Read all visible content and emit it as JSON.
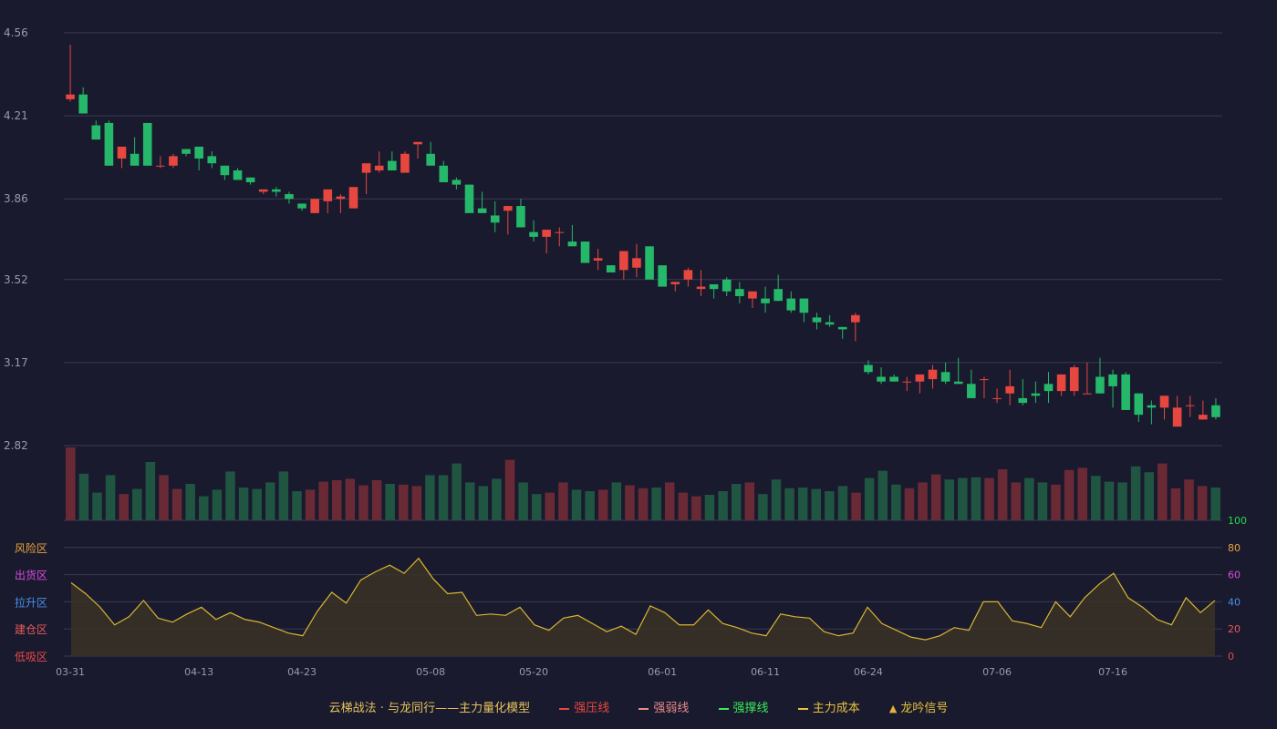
{
  "colors": {
    "background": "#191a2e",
    "up": "#e8473f",
    "down": "#25b86a",
    "up_volume": "#6a2a35",
    "down_volume": "#1f5541",
    "grid": "#3a3b52",
    "axis_text": "#9a9aa8",
    "oscillator_line": "#d9b531",
    "oscillator_fill": "#3a3326"
  },
  "chart_data": [
    {
      "type": "candlestick",
      "x": [
        "03-31",
        "04-01",
        "04-02",
        "04-03",
        "04-04",
        "04-07",
        "04-08",
        "04-09",
        "04-10",
        "04-11",
        "04-13",
        "04-14",
        "04-15",
        "04-16",
        "04-17",
        "04-18",
        "04-21",
        "04-22",
        "04-23",
        "04-24",
        "04-25",
        "04-28",
        "04-29",
        "04-30",
        "05-02",
        "05-05",
        "05-06",
        "05-07",
        "05-08",
        "05-09",
        "05-12",
        "05-13",
        "05-14",
        "05-15",
        "05-16",
        "05-19",
        "05-20",
        "05-21",
        "05-22",
        "05-23",
        "05-26",
        "05-27",
        "05-28",
        "05-29",
        "05-30",
        "05-31",
        "06-01",
        "06-03",
        "06-04",
        "06-05",
        "06-06",
        "06-07",
        "06-09",
        "06-10",
        "06-11",
        "06-12",
        "06-13",
        "06-16",
        "06-17",
        "06-18",
        "06-19",
        "06-20",
        "06-24",
        "06-25",
        "06-26",
        "06-27",
        "06-28",
        "06-30",
        "07-01",
        "07-02",
        "07-03",
        "07-04",
        "07-06",
        "07-07",
        "07-08",
        "07-09",
        "07-10",
        "07-11",
        "07-12",
        "07-13",
        "07-14",
        "07-16",
        "07-17",
        "07-18",
        "07-19",
        "07-20",
        "07-21",
        "07-22",
        "07-23",
        "07-24"
      ],
      "x_ticks": [
        "03-31",
        "04-13",
        "04-23",
        "05-08",
        "05-20",
        "06-01",
        "06-11",
        "06-24",
        "07-06",
        "07-16"
      ],
      "y_ticks": [
        "4.56",
        "4.21",
        "3.86",
        "3.52",
        "3.17",
        "2.82"
      ],
      "ylim": [
        2.82,
        4.56
      ],
      "open": [
        4.28,
        4.3,
        4.17,
        4.18,
        4.03,
        4.05,
        4.18,
        4.0,
        4.0,
        4.07,
        4.08,
        4.04,
        4.0,
        3.98,
        3.95,
        3.89,
        3.9,
        3.88,
        3.84,
        3.8,
        3.85,
        3.86,
        3.82,
        3.97,
        3.98,
        4.02,
        3.97,
        4.09,
        4.05,
        4.0,
        3.94,
        3.92,
        3.82,
        3.79,
        3.81,
        3.83,
        3.72,
        3.7,
        3.72,
        3.68,
        3.68,
        3.6,
        3.58,
        3.56,
        3.57,
        3.66,
        3.58,
        3.5,
        3.52,
        3.48,
        3.5,
        3.52,
        3.48,
        3.44,
        3.44,
        3.48,
        3.44,
        3.44,
        3.36,
        3.34,
        3.32,
        3.34,
        3.16,
        3.11,
        3.11,
        3.09,
        3.09,
        3.1,
        3.13,
        3.09,
        3.08,
        3.1,
        3.02,
        3.04,
        3.02,
        3.04,
        3.08,
        3.05,
        3.05,
        3.04,
        3.11,
        3.12,
        3.12,
        3.04,
        2.99,
        2.98,
        2.9,
        2.99,
        2.93,
        2.99
      ],
      "high": [
        4.51,
        4.33,
        4.19,
        4.19,
        4.06,
        4.12,
        4.18,
        4.04,
        4.05,
        4.07,
        4.08,
        4.06,
        4.0,
        3.99,
        3.95,
        3.89,
        3.91,
        3.89,
        3.84,
        3.86,
        3.9,
        3.88,
        3.84,
        3.98,
        4.06,
        4.06,
        4.06,
        4.09,
        4.1,
        4.02,
        3.95,
        3.92,
        3.89,
        3.85,
        3.83,
        3.86,
        3.77,
        3.71,
        3.74,
        3.75,
        3.68,
        3.65,
        3.58,
        3.64,
        3.67,
        3.66,
        3.58,
        3.51,
        3.57,
        3.56,
        3.5,
        3.53,
        3.51,
        3.46,
        3.49,
        3.54,
        3.47,
        3.44,
        3.38,
        3.37,
        3.32,
        3.38,
        3.18,
        3.15,
        3.12,
        3.11,
        3.12,
        3.16,
        3.17,
        3.19,
        3.14,
        3.11,
        3.06,
        3.14,
        3.1,
        3.09,
        3.13,
        3.12,
        3.16,
        3.17,
        3.19,
        3.14,
        3.13,
        3.04,
        3.01,
        3.03,
        3.03,
        3.03,
        3.01,
        3.02
      ],
      "low": [
        4.27,
        4.25,
        4.15,
        4.0,
        3.99,
        4.0,
        4.0,
        3.99,
        3.99,
        4.04,
        3.98,
        3.99,
        3.94,
        3.94,
        3.92,
        3.88,
        3.87,
        3.84,
        3.81,
        3.8,
        3.8,
        3.8,
        3.82,
        3.88,
        3.97,
        3.98,
        4.0,
        4.03,
        4.05,
        3.98,
        3.9,
        3.91,
        3.8,
        3.72,
        3.71,
        3.77,
        3.68,
        3.63,
        3.66,
        3.67,
        3.6,
        3.56,
        3.55,
        3.52,
        3.53,
        3.56,
        3.51,
        3.47,
        3.49,
        3.45,
        3.44,
        3.45,
        3.42,
        3.4,
        3.38,
        3.43,
        3.38,
        3.34,
        3.31,
        3.32,
        3.27,
        3.26,
        3.12,
        3.08,
        3.09,
        3.05,
        3.04,
        3.06,
        3.08,
        3.08,
        3.05,
        3.02,
        3.0,
        2.99,
        2.99,
        3.0,
        3.0,
        3.03,
        3.03,
        3.04,
        3.04,
        2.98,
        3.0,
        2.92,
        2.91,
        2.93,
        2.93,
        2.94,
        2.93,
        2.93
      ],
      "close": [
        4.3,
        4.22,
        4.11,
        4.0,
        4.08,
        4.0,
        4.0,
        4.0,
        4.04,
        4.05,
        4.03,
        4.01,
        3.96,
        3.94,
        3.93,
        3.9,
        3.89,
        3.86,
        3.82,
        3.86,
        3.9,
        3.87,
        3.91,
        4.01,
        4.0,
        3.98,
        4.05,
        4.1,
        4.0,
        3.93,
        3.92,
        3.8,
        3.8,
        3.76,
        3.83,
        3.74,
        3.7,
        3.73,
        3.72,
        3.66,
        3.59,
        3.61,
        3.55,
        3.64,
        3.61,
        3.52,
        3.49,
        3.51,
        3.56,
        3.49,
        3.48,
        3.47,
        3.45,
        3.47,
        3.42,
        3.43,
        3.39,
        3.38,
        3.34,
        3.33,
        3.31,
        3.37,
        3.13,
        3.09,
        3.09,
        3.09,
        3.12,
        3.14,
        3.09,
        3.08,
        3.02,
        3.1,
        3.02,
        3.07,
        3.0,
        3.03,
        3.05,
        3.12,
        3.15,
        3.04,
        3.04,
        3.07,
        2.97,
        2.95,
        2.98,
        3.03,
        2.98,
        2.99,
        2.95,
        2.94
      ]
    },
    {
      "type": "bar",
      "name_en": "volume",
      "values": [
        100,
        64,
        38,
        62,
        36,
        43,
        80,
        62,
        43,
        50,
        33,
        42,
        67,
        45,
        43,
        52,
        67,
        40,
        42,
        53,
        55,
        57,
        48,
        55,
        50,
        49,
        47,
        62,
        62,
        78,
        52,
        47,
        57,
        83,
        52,
        36,
        38,
        52,
        42,
        40,
        42,
        52,
        48,
        44,
        45,
        52,
        38,
        33,
        35,
        40,
        50,
        52,
        36,
        56,
        44,
        45,
        43,
        40,
        47,
        38,
        58,
        68,
        49,
        44,
        52,
        63,
        56,
        58,
        59,
        58,
        70,
        52,
        58,
        52,
        49,
        69,
        72,
        61,
        53,
        52,
        74,
        66,
        78,
        44,
        56,
        47,
        45
      ],
      "ylim": [
        0,
        100
      ]
    },
    {
      "type": "area",
      "values": [
        54,
        46,
        36,
        23,
        29,
        41,
        28,
        25,
        31,
        36,
        27,
        32,
        27,
        25,
        21,
        17,
        15,
        33,
        47,
        39,
        56,
        62,
        67,
        61,
        72,
        57,
        46,
        47,
        30,
        31,
        30,
        36,
        23,
        19,
        28,
        30,
        24,
        18,
        22,
        16,
        37,
        32,
        23,
        23,
        34,
        24,
        21,
        17,
        15,
        31,
        29,
        28,
        18,
        15,
        17,
        36,
        24,
        19,
        14,
        12,
        15,
        21,
        19,
        40,
        40,
        26,
        24,
        21,
        40,
        29,
        43,
        53,
        61,
        43,
        36,
        27,
        23,
        43,
        32,
        41
      ],
      "ylim": [
        0,
        100
      ],
      "y_ticks": [
        "100",
        "80",
        "60",
        "40",
        "20",
        "0"
      ],
      "zones": [
        {
          "label": "风险区",
          "color": "#e8a33a"
        },
        {
          "label": "出货区",
          "color": "#d94ad9"
        },
        {
          "label": "拉升区",
          "color": "#4a8fe8"
        },
        {
          "label": "建仓区",
          "color": "#e85a5a"
        },
        {
          "label": "低吸区",
          "color": "#e84a4a"
        }
      ],
      "tick_colors": [
        "#22d84a",
        "#e8a33a",
        "#d94ad9",
        "#4a8fe8",
        "#e85a5a",
        "#e84a4a"
      ]
    }
  ],
  "legend": {
    "title": "云梯战法 · 与龙同行——主力量化模型",
    "items": [
      {
        "label": "强压线",
        "color": "#e8473f",
        "style": "solid"
      },
      {
        "label": "强弱线",
        "color": "#e88a8a",
        "style": "dashed"
      },
      {
        "label": "强撑线",
        "color": "#3ae85a",
        "style": "solid"
      },
      {
        "label": "主力成本",
        "color": "#e8c23a",
        "style": "dashed"
      },
      {
        "label": "龙吟信号",
        "color": "#e8b23a",
        "style": "triangle"
      }
    ]
  }
}
